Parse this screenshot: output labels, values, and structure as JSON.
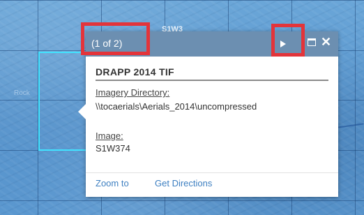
{
  "map": {
    "tile_label": "S1W3",
    "left_label": "Rock",
    "colors": {
      "selected_outline": "#42e3ff",
      "highlight_box": "#e3343a"
    }
  },
  "popup": {
    "count": "(1 of 2)",
    "icons": {
      "next": "next-arrow-icon",
      "maximize": "maximize-icon",
      "close": "close-icon"
    },
    "close_glyph": "✕",
    "title": "DRAPP 2014 TIF",
    "fields": [
      {
        "label": "Imagery Directory:",
        "value": "\\\\tocaerials\\Aerials_2014\\uncompressed"
      },
      {
        "label": "Image:",
        "value": "S1W374"
      }
    ],
    "actions": {
      "zoom_to": "Zoom to",
      "get_directions": "Get Directions"
    },
    "header_color": "#6c8fb1",
    "link_color": "#3d7fc1"
  }
}
